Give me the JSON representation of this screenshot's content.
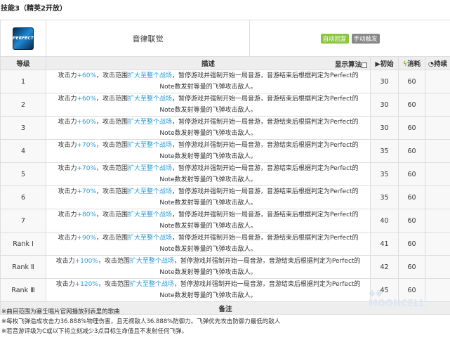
{
  "title": "技能3（精英2开放）",
  "skill": {
    "name": "音律联觉",
    "icon_text": "PERFECT",
    "tags": [
      {
        "label": "自动回复",
        "color": "#8cc63f"
      },
      {
        "label": "手动触发",
        "color": "#888888"
      }
    ]
  },
  "headers": {
    "level": "等级",
    "desc": "描述",
    "show_formula": "显示算法",
    "init": "初始",
    "cost": "消耗",
    "duration": "持续"
  },
  "rows": [
    {
      "level": "1",
      "atk": "+60%",
      "init": "30",
      "cost": "60"
    },
    {
      "level": "2",
      "atk": "+60%",
      "init": "30",
      "cost": "60"
    },
    {
      "level": "3",
      "atk": "+60%",
      "init": "30",
      "cost": "60"
    },
    {
      "level": "4",
      "atk": "+70%",
      "init": "35",
      "cost": "60"
    },
    {
      "level": "5",
      "atk": "+70%",
      "init": "35",
      "cost": "60"
    },
    {
      "level": "6",
      "atk": "+70%",
      "init": "35",
      "cost": "60"
    },
    {
      "level": "7",
      "atk": "+80%",
      "init": "40",
      "cost": "60"
    },
    {
      "level": "Rank Ⅰ",
      "atk": "+90%",
      "init": "41",
      "cost": "60"
    },
    {
      "level": "Rank Ⅱ",
      "atk": "+100%",
      "init": "42",
      "cost": "60"
    },
    {
      "level": "Rank Ⅲ",
      "atk": "+120%",
      "init": "45",
      "cost": "60"
    }
  ],
  "desc_parts": {
    "a": "攻击力",
    "b": "，攻击范围",
    "c": "扩大至整个战场",
    "d": "，暂停游戏并强制开始一局音游，音游结束后根据判定为Perfect的Note数发射等量的飞弹攻击敌人。"
  },
  "notes_title": "备注",
  "notes": [
    "※曲目范围为塞壬唱片官网播放列表里的歌曲",
    "※每枚飞弹造成攻击力36.888%物理伤害，且无视敌人36.888%防御力。飞弹优先攻击防御力最低的敌人",
    "※若音游评级为C或以下将立刻减少3点目标生命值且不发射任何飞弹。"
  ],
  "watermark": "MOONCELL"
}
